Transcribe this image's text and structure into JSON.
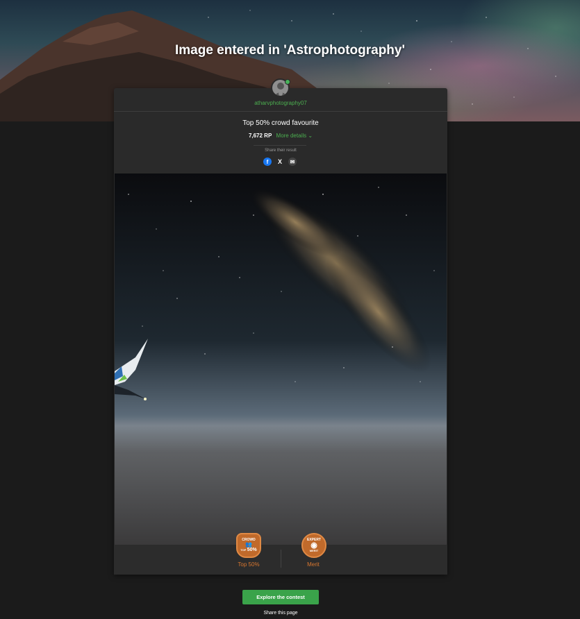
{
  "hero": {
    "title": "Image entered in 'Astrophotography'"
  },
  "entry": {
    "username": "atharvphotography07",
    "result": "Top 50% crowd favourite",
    "rp": "7,672 RP",
    "more_details": "More details",
    "share_label": "Share their result"
  },
  "share": {
    "facebook_glyph": "f",
    "x_glyph": "X",
    "email_glyph": "✉"
  },
  "badges": {
    "crowd": {
      "top": "CROWD",
      "mid": "TOP",
      "pct": "50%",
      "label": "Top 50%"
    },
    "expert": {
      "top": "EXPERT",
      "bottom": "MERIT",
      "label": "Merit"
    }
  },
  "cta": {
    "explore": "Explore the contest",
    "share_page": "Share this page"
  },
  "colors": {
    "accent": "#3aa34a",
    "badge": "#c06a2b"
  }
}
